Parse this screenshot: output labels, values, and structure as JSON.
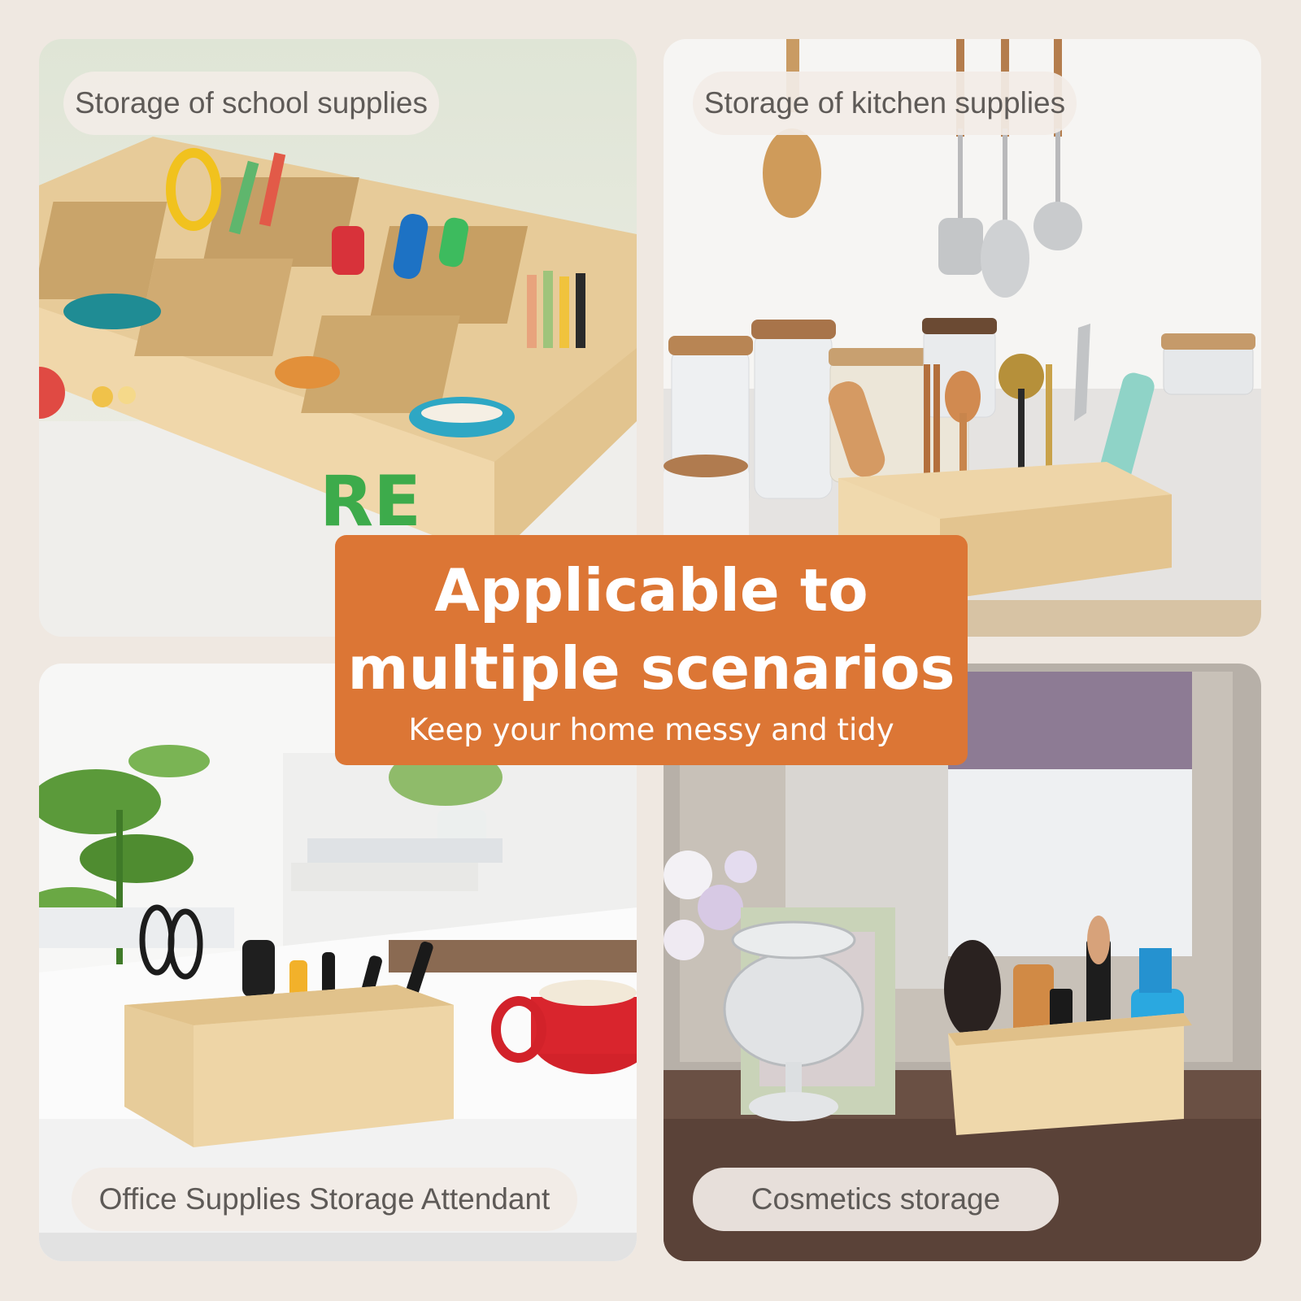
{
  "scenarios": [
    {
      "caption": "Storage of school supplies"
    },
    {
      "caption": "Storage of kitchen supplies"
    },
    {
      "caption": "Office Supplies Storage Attendant"
    },
    {
      "caption": "Cosmetics storage"
    }
  ],
  "banner": {
    "title": "Applicable to multiple scenarios",
    "subtitle": "Keep your home messy and tidy"
  },
  "school_box_letters": "RE",
  "colors": {
    "background": "#efe8e1",
    "banner": "#dc7635",
    "pill": "#f2ece6",
    "caption_text": "#5e5a57",
    "wood": "#ecd3a4"
  }
}
